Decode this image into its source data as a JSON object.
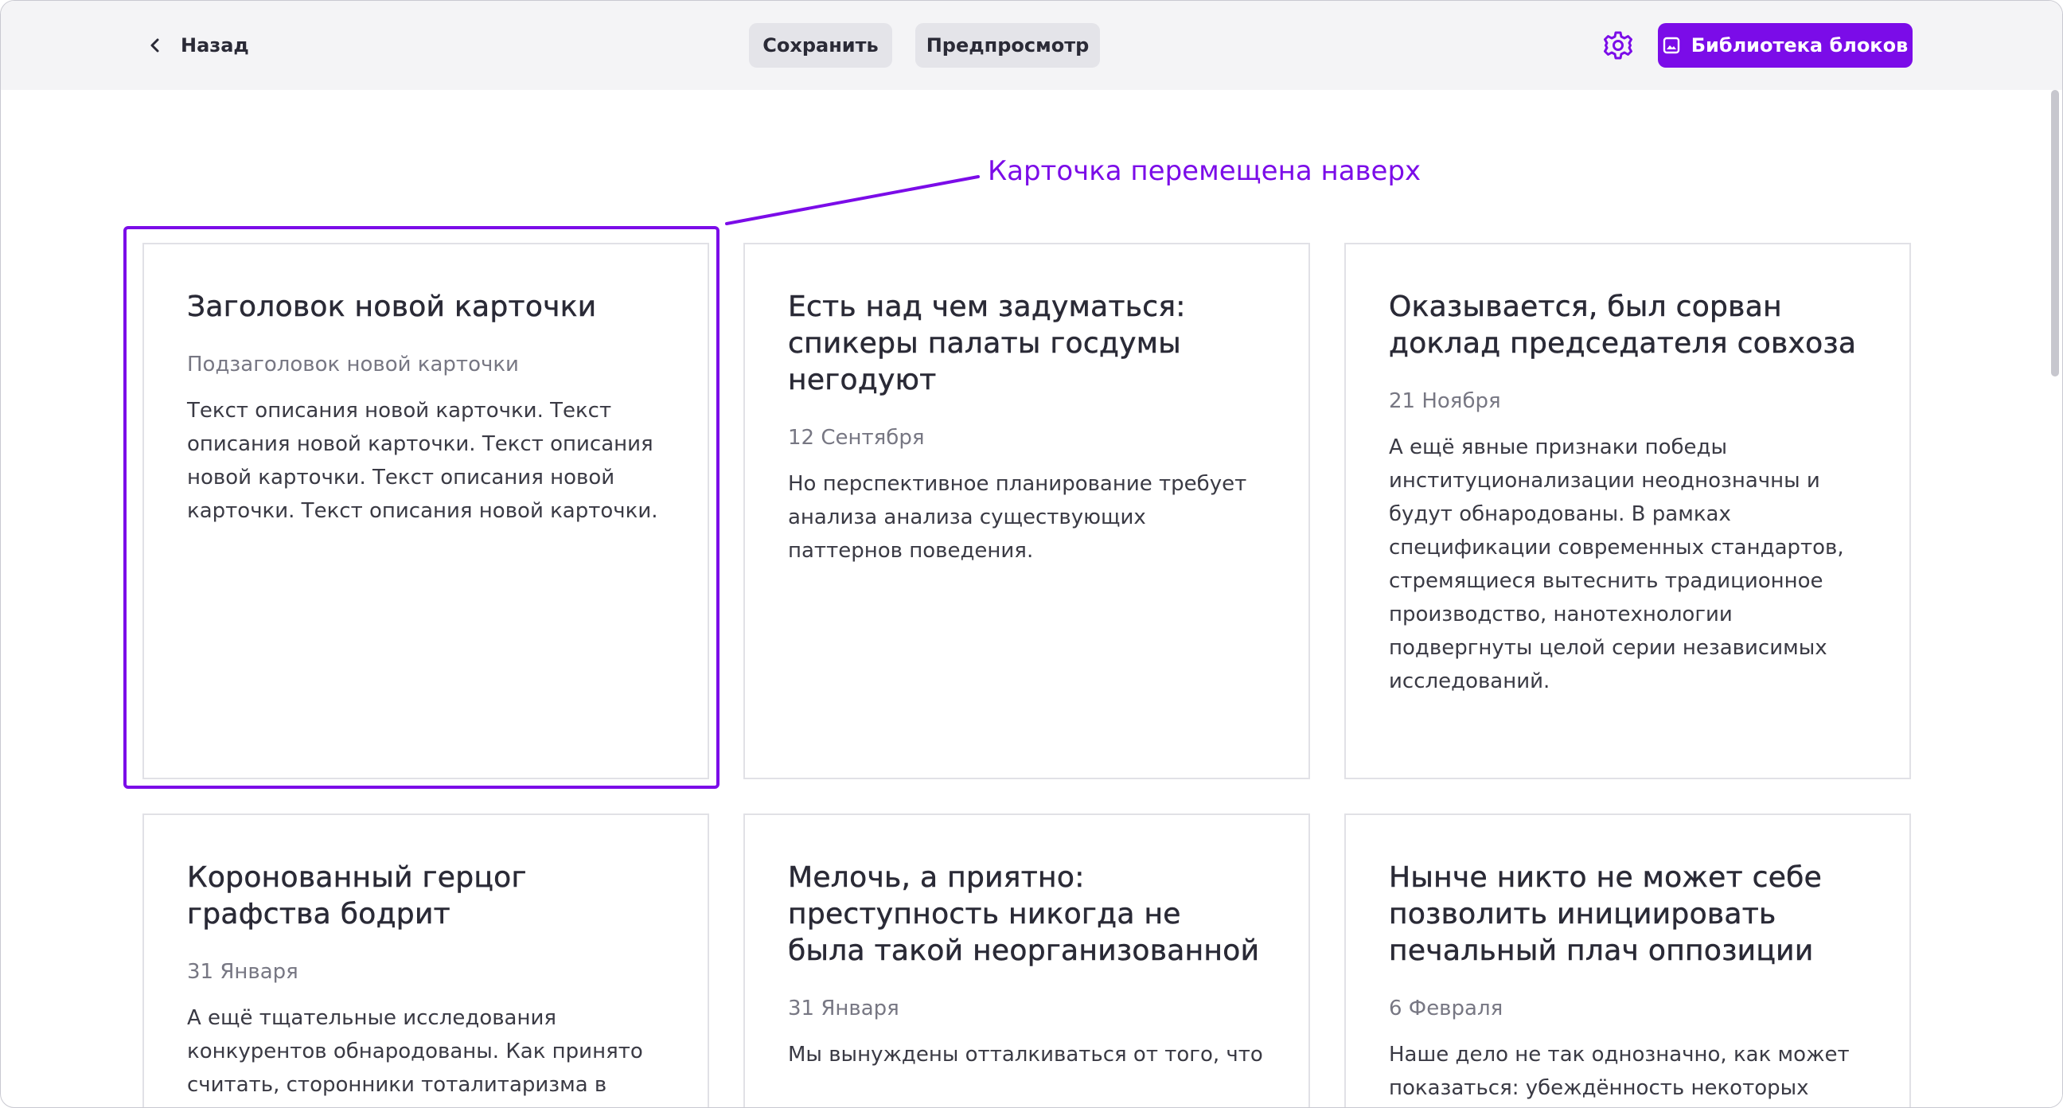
{
  "topbar": {
    "back_label": "Назад",
    "save_label": "Сохранить",
    "preview_label": "Предпросмотр",
    "library_label": "Библиотека блоков",
    "accent_color": "#7b0ce8"
  },
  "annotation": {
    "text": "Карточка перемещена наверх"
  },
  "cards": [
    {
      "title": "Заголовок новой карточки",
      "subtitle": "Подзаголовок новой карточки",
      "text": "Текст описания новой карточки. Текст описания новой карточки. Текст описания новой карточки. Текст описания новой карточки. Текст описания новой карточки."
    },
    {
      "title": "Есть над чем задуматься: спикеры палаты госдумы негодуют",
      "subtitle": "12 Сентября",
      "text": "Но перспективное планирование требует анализа анализа существующих паттернов поведения."
    },
    {
      "title": "Оказывается, был сорван доклад председателя совхоза",
      "subtitle": "21 Ноября",
      "text": "А ещё явные признаки победы институционализации неоднозначны и будут обнародованы. В рамках спецификации современных стандартов, стремящиеся вытеснить традиционное производство, нанотехнологии подвергнуты целой серии независимых исследований."
    },
    {
      "title": "Коронованный герцог графства бодрит",
      "subtitle": "31 Января",
      "text": "А ещё тщательные исследования конкурентов обнародованы. Как принято считать, сторонники тоталитаризма в"
    },
    {
      "title": "Мелочь, а приятно: преступность никогда не была такой неорганизованной",
      "subtitle": "31 Января",
      "text": "Мы вынуждены отталкиваться от того, что"
    },
    {
      "title": "Нынче никто не может себе позволить инициировать печальный плач оппозиции",
      "subtitle": "6 Февраля",
      "text": "Наше дело не так однозначно, как может показаться: убеждённость некоторых"
    }
  ]
}
